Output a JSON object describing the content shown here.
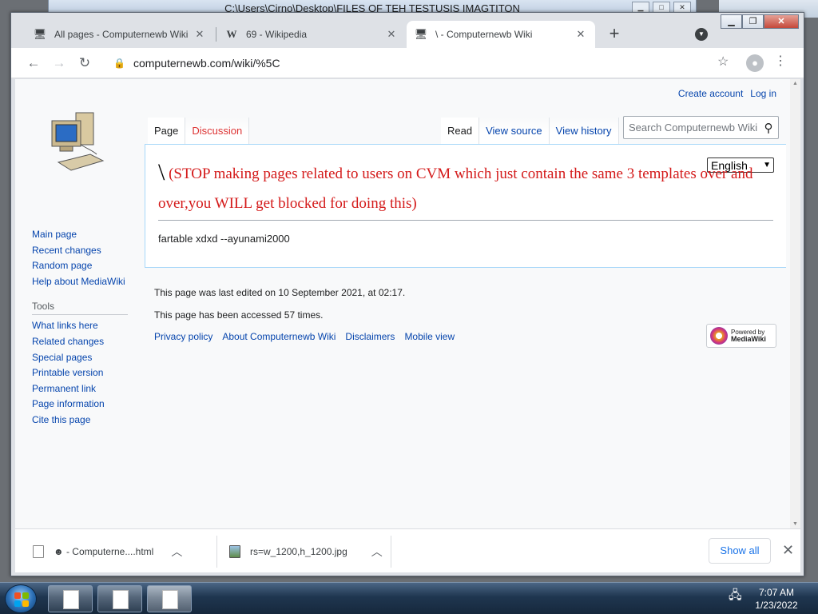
{
  "background_window": {
    "title": "C:\\Users\\Cirno\\Desktop\\FILES OF TEH TESTUSIS IMAGTITON"
  },
  "browser": {
    "tabs": [
      {
        "title": "All pages - Computernewb Wiki",
        "icon": "wiki-globe-icon",
        "active": false
      },
      {
        "title": "69 - Wikipedia",
        "icon": "wikipedia-w-icon",
        "active": false
      },
      {
        "title": "\\ - Computernewb Wiki",
        "icon": "wiki-globe-icon",
        "active": true
      }
    ],
    "url": "computernewb.com/wiki/%5C"
  },
  "wiki": {
    "user_links": {
      "create_account": "Create account",
      "log_in": "Log in"
    },
    "sidebar": {
      "main": [
        "Main page",
        "Recent changes",
        "Random page",
        "Help about MediaWiki"
      ],
      "tools_heading": "Tools",
      "tools": [
        "What links here",
        "Related changes",
        "Special pages",
        "Printable version",
        "Permanent link",
        "Page information",
        "Cite this page"
      ]
    },
    "tabs_left": {
      "page": "Page",
      "discussion": "Discussion"
    },
    "tabs_right": {
      "read": "Read",
      "view_source": "View source",
      "view_history": "View history"
    },
    "search_placeholder": "Search Computernewb Wiki",
    "language": "English",
    "title_symbol": "\\",
    "title_text": "(STOP making pages related to users on CVM which just contain the same 3 templates over and over,you WILL get blocked for doing this)",
    "body_text": "fartable xdxd --ayunami2000",
    "footer": {
      "last_edited": "This page was last edited on 10 September 2021, at 02:17.",
      "accessed": "This page has been accessed 57 times.",
      "links": [
        "Privacy policy",
        "About Computernewb Wiki",
        "Disclaimers",
        "Mobile view"
      ],
      "powered_by_line1": "Powered by",
      "powered_by_line2": "MediaWiki"
    }
  },
  "downloads": {
    "items": [
      {
        "name": "☻ - Computerne....html"
      },
      {
        "name": "rs=w_1200,h_1200.jpg"
      }
    ],
    "show_all": "Show all"
  },
  "taskbar": {
    "time": "7:07 AM",
    "date": "1/23/2022"
  },
  "colors": {
    "link": "#0645ad",
    "title_red": "#d41a1a",
    "new_link_red": "#d33",
    "chrome_tabstrip": "#dee1e6"
  }
}
